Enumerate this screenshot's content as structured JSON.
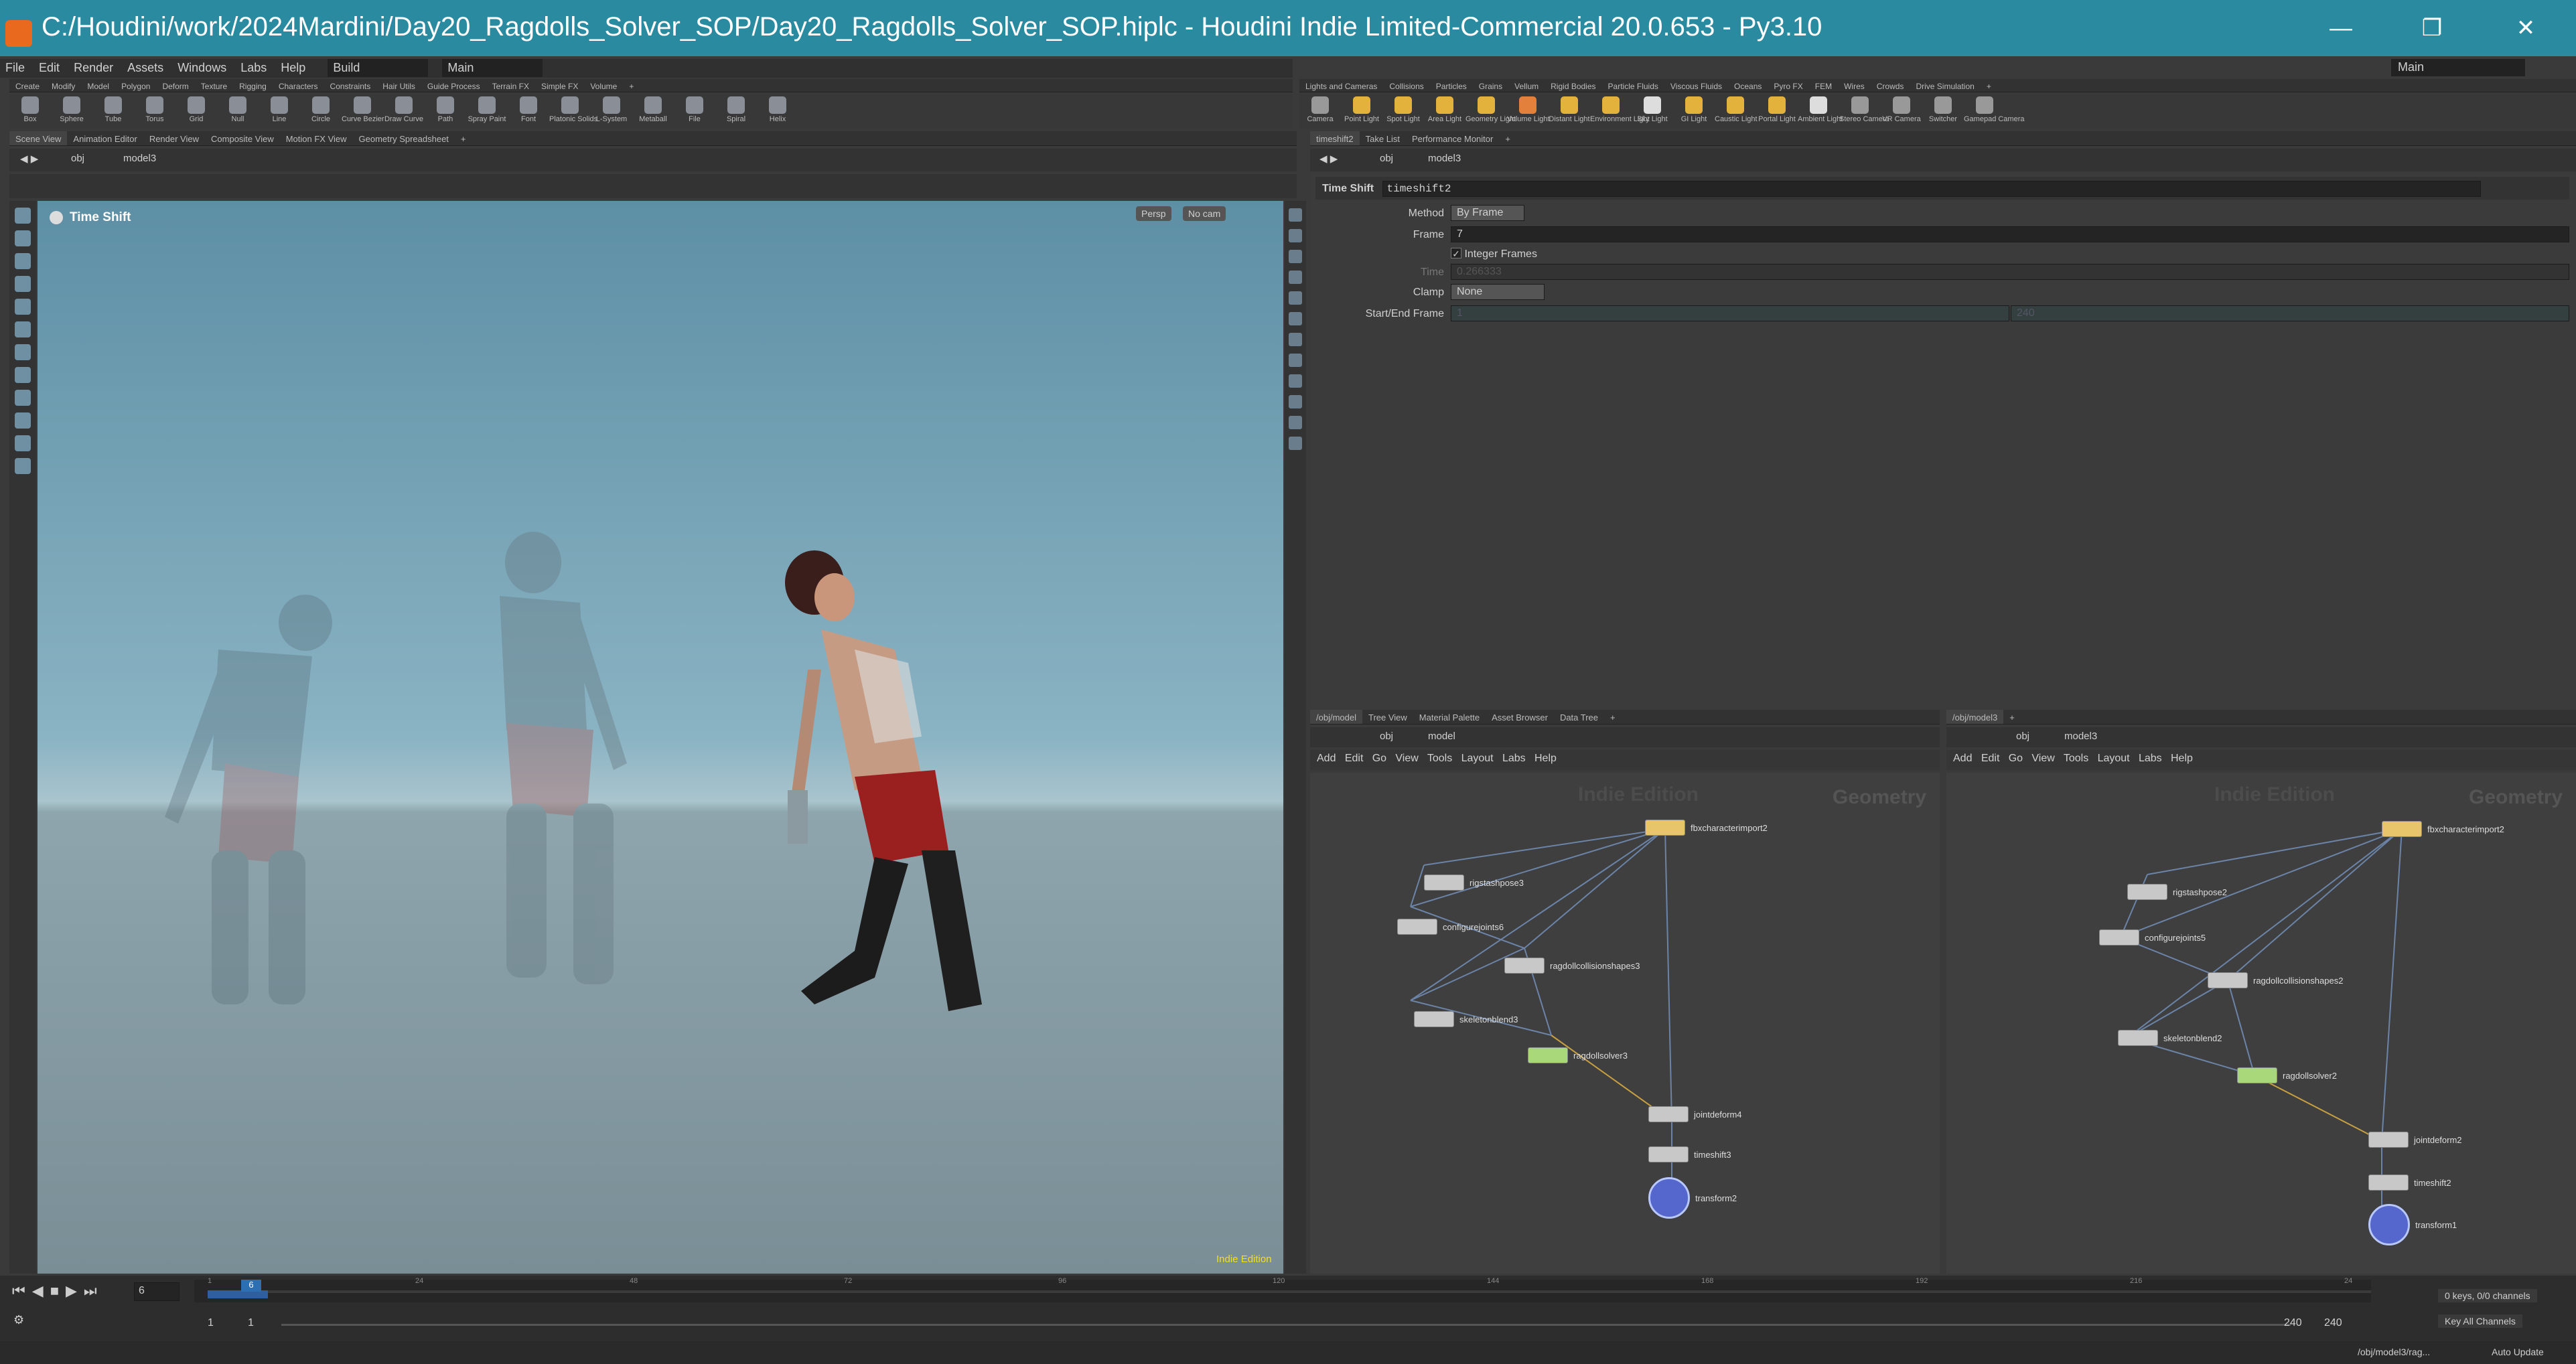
{
  "window": {
    "title": "C:/Houdini/work/2024Mardini/Day20_Ragdolls_Solver_SOP/Day20_Ragdolls_Solver_SOP.hiplc - Houdini Indie Limited-Commercial 20.0.653 - Py3.10",
    "min_glyph": "—",
    "max_glyph": "❐",
    "close_glyph": "✕"
  },
  "menu": [
    "File",
    "Edit",
    "Render",
    "Assets",
    "Windows",
    "Labs",
    "Help"
  ],
  "desktop": {
    "build": "Build",
    "main_left": "Main",
    "main_right": "Main"
  },
  "shelf_tabs_left": [
    "Create",
    "Modify",
    "Model",
    "Polygon",
    "Deform",
    "Texture",
    "Rigging",
    "Characters",
    "Constraints",
    "Hair Utils",
    "Guide Process",
    "Terrain FX",
    "Simple FX",
    "Volume",
    "+"
  ],
  "shelf_tools_left": [
    "Box",
    "Sphere",
    "Tube",
    "Torus",
    "Grid",
    "Null",
    "Line",
    "Circle",
    "Curve Bezier",
    "Draw Curve",
    "Path",
    "Spray Paint",
    "Font",
    "Platonic Solids",
    "L-System",
    "Metaball",
    "File",
    "Spiral",
    "Helix"
  ],
  "shelf_tabs_right": [
    "Lights and Cameras",
    "Collisions",
    "Particles",
    "Grains",
    "Vellum",
    "Rigid Bodies",
    "Particle Fluids",
    "Viscous Fluids",
    "Oceans",
    "Pyro FX",
    "FEM",
    "Wires",
    "Crowds",
    "Drive Simulation",
    "+"
  ],
  "shelf_tools_right": [
    "Camera",
    "Point Light",
    "Spot Light",
    "Area Light",
    "Geometry Light",
    "Volume Light",
    "Distant Light",
    "Environment Light",
    "Sky Light",
    "GI Light",
    "Caustic Light",
    "Portal Light",
    "Ambient Light",
    "Stereo Camera",
    "VR Camera",
    "Switcher",
    "Gamepad Camera"
  ],
  "pane_tabs_left": [
    "Scene View",
    "Animation Editor",
    "Render View",
    "Composite View",
    "Motion FX View",
    "Geometry Spreadsheet",
    "+"
  ],
  "pane_tabs_right": [
    "timeshift2",
    "Take List",
    "Performance Monitor",
    "+"
  ],
  "viewport": {
    "path_obj": "obj",
    "path_model": "model3",
    "node_label": "Time Shift",
    "persp": "Persp",
    "cam": "No cam",
    "edition": "Indie Edition"
  },
  "params": {
    "path_obj": "obj",
    "path_model": "model3",
    "node_type": "Time Shift",
    "node_name": "timeshift2",
    "method_label": "Method",
    "method_value": "By Frame",
    "frame_label": "Frame",
    "frame_value": "7",
    "integer_frames_label": "Integer Frames",
    "time_label": "Time",
    "time_value": "0.266333",
    "clamp_label": "Clamp",
    "clamp_value": "None",
    "startend_label": "Start/End Frame",
    "start_value": "1",
    "end_value": "240"
  },
  "net_tabs_left": [
    "/obj/model",
    "Tree View",
    "Material Palette",
    "Asset Browser",
    "Data Tree",
    "+"
  ],
  "net_tabs_right": [
    "/obj/model3",
    "+"
  ],
  "net_menu": [
    "Add",
    "Edit",
    "Go",
    "View",
    "Tools",
    "Layout",
    "Labs",
    "Help"
  ],
  "net_left": {
    "path_obj": "obj",
    "path_model": "model",
    "watermark": "Indie Edition",
    "context": "Geometry",
    "nodes": [
      "fbxcharacterimport2",
      "rigstashpose3",
      "configurejoints6",
      "ragdollcollisionshapes3",
      "skeletonblend3",
      "ragdollsolver3",
      "jointdeform4",
      "timeshift3",
      "transform2"
    ]
  },
  "net_right": {
    "path_obj": "obj",
    "path_model": "model3",
    "watermark": "Indie Edition",
    "context": "Geometry",
    "nodes": [
      "fbxcharacterimport2",
      "rigstashpose2",
      "configurejoints5",
      "ragdollcollisionshapes2",
      "skeletonblend2",
      "ragdollsolver2",
      "jointdeform2",
      "timeshift2",
      "transform1"
    ]
  },
  "timeline": {
    "current_frame": "6",
    "frame_marker": "6",
    "ticks": [
      "1",
      "24",
      "48",
      "72",
      "96",
      "120",
      "144",
      "168",
      "192",
      "216",
      "24"
    ],
    "start": "1",
    "start2": "1",
    "end": "240",
    "end2": "240",
    "keys": "0 keys, 0/0 channels",
    "key_all": "Key All Channels",
    "status_path": "/obj/model3/rag...",
    "auto_update": "Auto Update"
  },
  "colors": {
    "titlebar": "#2a8aa0",
    "accent": "#e96a1f"
  }
}
